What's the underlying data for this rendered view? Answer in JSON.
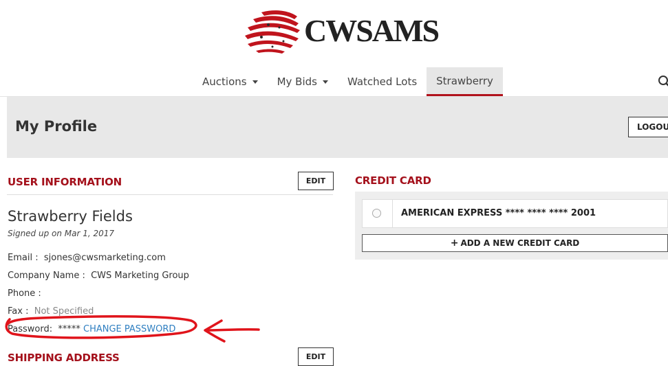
{
  "brand": {
    "name": "CWSAMS",
    "accent": "#b1121c"
  },
  "nav": {
    "items": [
      {
        "label": "Auctions",
        "dropdown": true
      },
      {
        "label": "My Bids",
        "dropdown": true
      },
      {
        "label": "Watched Lots",
        "dropdown": false
      },
      {
        "label": "Strawberry",
        "dropdown": false,
        "active": true
      }
    ],
    "search_icon": "search-icon"
  },
  "header": {
    "title": "My Profile",
    "logout_label": "LOGOUT"
  },
  "user_info": {
    "section_title": "USER INFORMATION",
    "edit_label": "EDIT",
    "name": "Strawberry Fields",
    "signed_up": "Signed up on Mar 1, 2017",
    "email_label": "Email :",
    "email_value": "sjones@cwsmarketing.com",
    "company_label": "Company Name :",
    "company_value": "CWS Marketing Group",
    "phone_label": "Phone :",
    "phone_value": "",
    "fax_label": "Fax :",
    "fax_value": "Not Specified",
    "password_label": "Password:",
    "password_value": "*****",
    "change_password_label": "CHANGE PASSWORD"
  },
  "shipping": {
    "section_title": "SHIPPING ADDRESS",
    "edit_label": "EDIT"
  },
  "credit_card": {
    "section_title": "CREDIT CARD",
    "cards": [
      {
        "label": "AMERICAN EXPRESS **** **** **** 2001"
      }
    ],
    "add_label": "ADD A NEW CREDIT CARD"
  },
  "annotation_color": "#e0141b"
}
